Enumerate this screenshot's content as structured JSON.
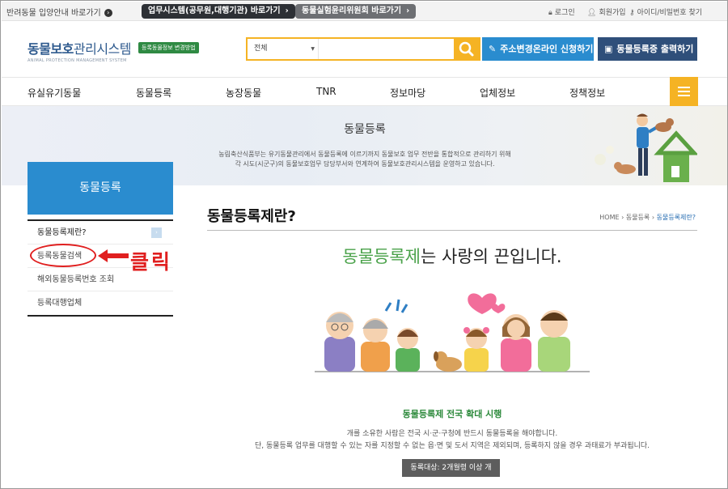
{
  "topbar": {
    "guide_link": "반려동물 입양안내 바로가기",
    "work_system_btn": "업무시스템(공무원,대행기관) 바로가기",
    "ethics_committee_btn": "동물실험윤리위원회 바로가기",
    "login": "로그인",
    "signup": "회원가입",
    "find_account": "아이디/비밀번호 찾기"
  },
  "header": {
    "logo_main_a": "동물보호",
    "logo_main_b": "관리시스템",
    "logo_sub": "ANIMAL PROTECTION MANAGEMENT SYSTEM",
    "badge": "등록동물정보 변경방법",
    "search_select": "전체",
    "search_placeholder": "",
    "address_change_btn": "주소변경온라인 신청하기",
    "print_btn": "동물등록증 출력하기"
  },
  "nav": {
    "items": [
      "유실유기동물",
      "동물등록",
      "농장동물",
      "TNR",
      "정보마당",
      "업체정보",
      "정책정보"
    ]
  },
  "banner": {
    "title": "동물등록",
    "desc_line1": "농림축산식품부는 유기동물관리에서 동물등록에 이르기까지 동물보호 업무 전반을 통합적으로 관리하기 위해",
    "desc_line2": "각 시도(시군구)의 동물보호업무 담당부서와 연계하여 동물보호관리시스템을 운영하고 있습니다."
  },
  "sidebar": {
    "heading": "동물등록",
    "items": [
      "동물등록제란?",
      "등록동물검색",
      "해외동물등록번호 조회",
      "등록대행업체"
    ]
  },
  "annotation": {
    "click_text": "클릭"
  },
  "content": {
    "title": "동물등록제란?",
    "breadcrumb": [
      "HOME",
      "동물등록",
      "동물등록제란?"
    ],
    "slogan_highlight": "동물등록제",
    "slogan_rest": "는 사랑의 끈입니다.",
    "section_title": "동물등록제 전국 확대 시행",
    "section_desc1": "개를 소유한 사람은 전국 시·군·구청에 반드시 동물등록을 해야합니다.",
    "section_desc2": "단, 동물등록 업무를 대행할 수 있는 자를 지정할 수 없는 읍·면 및 도서 지역은 제외되며, 등록하지 않을 경우 과태료가 부과됩니다.",
    "target_btn": "동록대상: 2개월령 이상 개"
  },
  "colors": {
    "accent_yellow": "#f5b324",
    "blue_btn": "#2a8ccf",
    "navy_btn": "#2f4f7a",
    "dark_pill": "#2d3035",
    "grey_pill": "#6d6f73",
    "green": "#4aa24a",
    "annotation_red": "#e01f1f"
  }
}
